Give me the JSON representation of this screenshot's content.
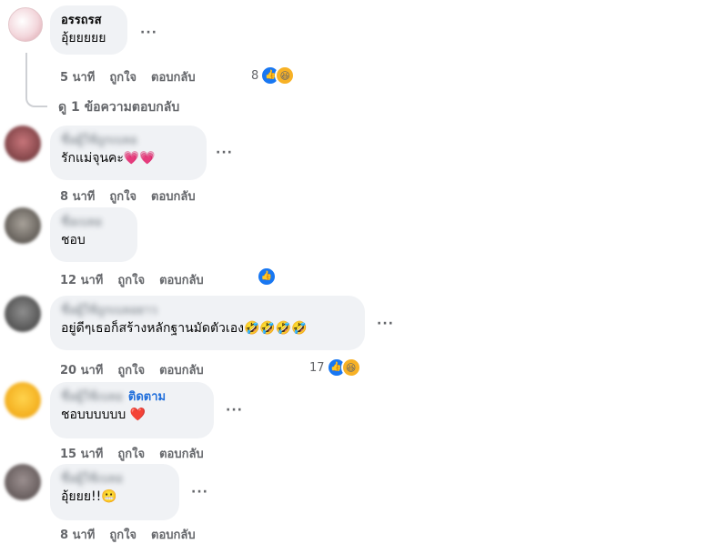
{
  "comments": [
    {
      "author": "อรรถรส",
      "text": "อุ้ยยยยย",
      "time": "5 นาที",
      "like": "ถูกใจ",
      "reply": "ตอบกลับ",
      "reaction_count": "8",
      "reactions": [
        "like",
        "haha"
      ],
      "more": "···"
    },
    {
      "author": "ชื่อผู้ใช้ถูกเบลอ",
      "text": "รักแม่จุนคะ💗💗",
      "time": "8 นาที",
      "like": "ถูกใจ",
      "reply": "ตอบกลับ",
      "more": "···"
    },
    {
      "author": "ชื่อเบลอ",
      "text": "ชอบ",
      "time": "12 นาที",
      "like": "ถูกใจ",
      "reply": "ตอบกลับ",
      "reactions": [
        "like"
      ]
    },
    {
      "author": "ชื่อผู้ใช้ถูกเบลอยาว",
      "text": "อยู่ดีๆเธอก็สร้างหลักฐานมัดตัวเอง🤣🤣🤣🤣",
      "time": "20 นาที",
      "like": "ถูกใจ",
      "reply": "ตอบกลับ",
      "reaction_count": "17",
      "reactions": [
        "like",
        "haha"
      ],
      "more": "···"
    },
    {
      "author": "ชื่อผู้ใช้เบลอ",
      "follow": "ติดตาม",
      "text": "ชอบบบบบบ ❤️",
      "time": "15 นาที",
      "like": "ถูกใจ",
      "reply": "ตอบกลับ",
      "more": "···"
    },
    {
      "author": "ชื่อผู้ใช้เบลอ",
      "text": "อุ้ยยย!!😬",
      "time": "8 นาที",
      "like": "ถูกใจ",
      "reply": "ตอบกลับ",
      "more": "···"
    }
  ],
  "view_replies": "ดู 1 ข้อความตอบกลับ",
  "colors": {
    "bubble": "#f0f2f5",
    "muted": "#65676b",
    "like_blue": "#1877f2",
    "follow_blue": "#216fdb"
  },
  "icons": {
    "like": "like-reaction-icon",
    "haha": "haha-reaction-icon",
    "more": "more-options-icon"
  }
}
